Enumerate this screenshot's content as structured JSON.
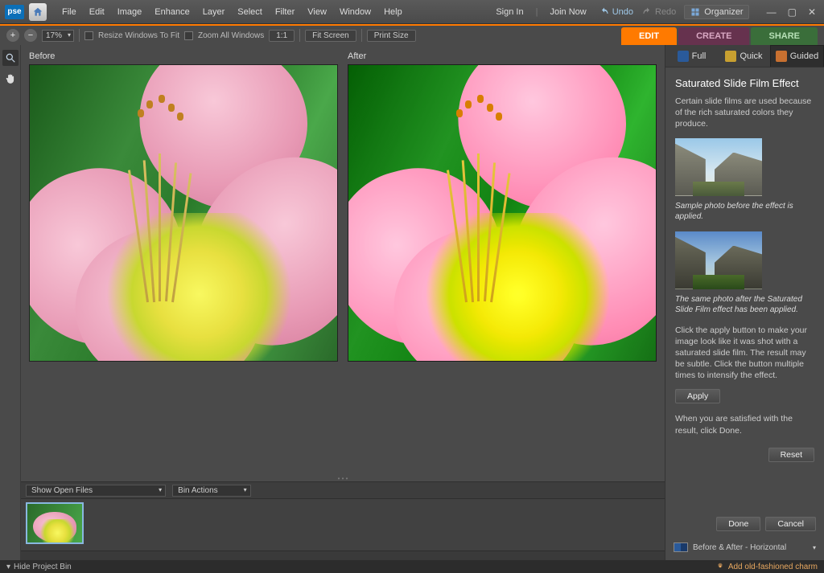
{
  "app": {
    "logo": "pse"
  },
  "menu": [
    "File",
    "Edit",
    "Image",
    "Enhance",
    "Layer",
    "Select",
    "Filter",
    "View",
    "Window",
    "Help"
  ],
  "top_right": {
    "signin": "Sign In",
    "joinnow": "Join Now",
    "undo": "Undo",
    "redo": "Redo",
    "organizer": "Organizer"
  },
  "options": {
    "zoom": "17%",
    "resize_windows": "Resize Windows To Fit",
    "zoom_all": "Zoom All Windows",
    "one_to_one": "1:1",
    "fit_screen": "Fit Screen",
    "print_size": "Print Size"
  },
  "main_tabs": {
    "edit": "EDIT",
    "create": "CREATE",
    "share": "SHARE"
  },
  "sub_tabs": {
    "full": "Full",
    "quick": "Quick",
    "guided": "Guided"
  },
  "before_after": {
    "before": "Before",
    "after": "After"
  },
  "panel": {
    "title": "Saturated Slide Film Effect",
    "intro": "Certain slide films are used because of the rich saturated colors they produce.",
    "caption1": "Sample photo before the effect is applied.",
    "caption2": "The same photo after the Saturated Slide Film effect has been applied.",
    "instructions": "Click the apply button to make your image look like it was shot with a saturated slide film. The result may be subtle. Click the button multiple times to intensify the effect.",
    "apply": "Apply",
    "satisfied": "When you are satisfied with the result, click Done.",
    "reset": "Reset",
    "done": "Done",
    "cancel": "Cancel",
    "ba_mode": "Before & After - Horizontal"
  },
  "bin": {
    "show_open": "Show Open Files",
    "actions": "Bin Actions"
  },
  "status": {
    "hide_bin": "Hide Project Bin",
    "tip": "Add old-fashioned charm"
  }
}
